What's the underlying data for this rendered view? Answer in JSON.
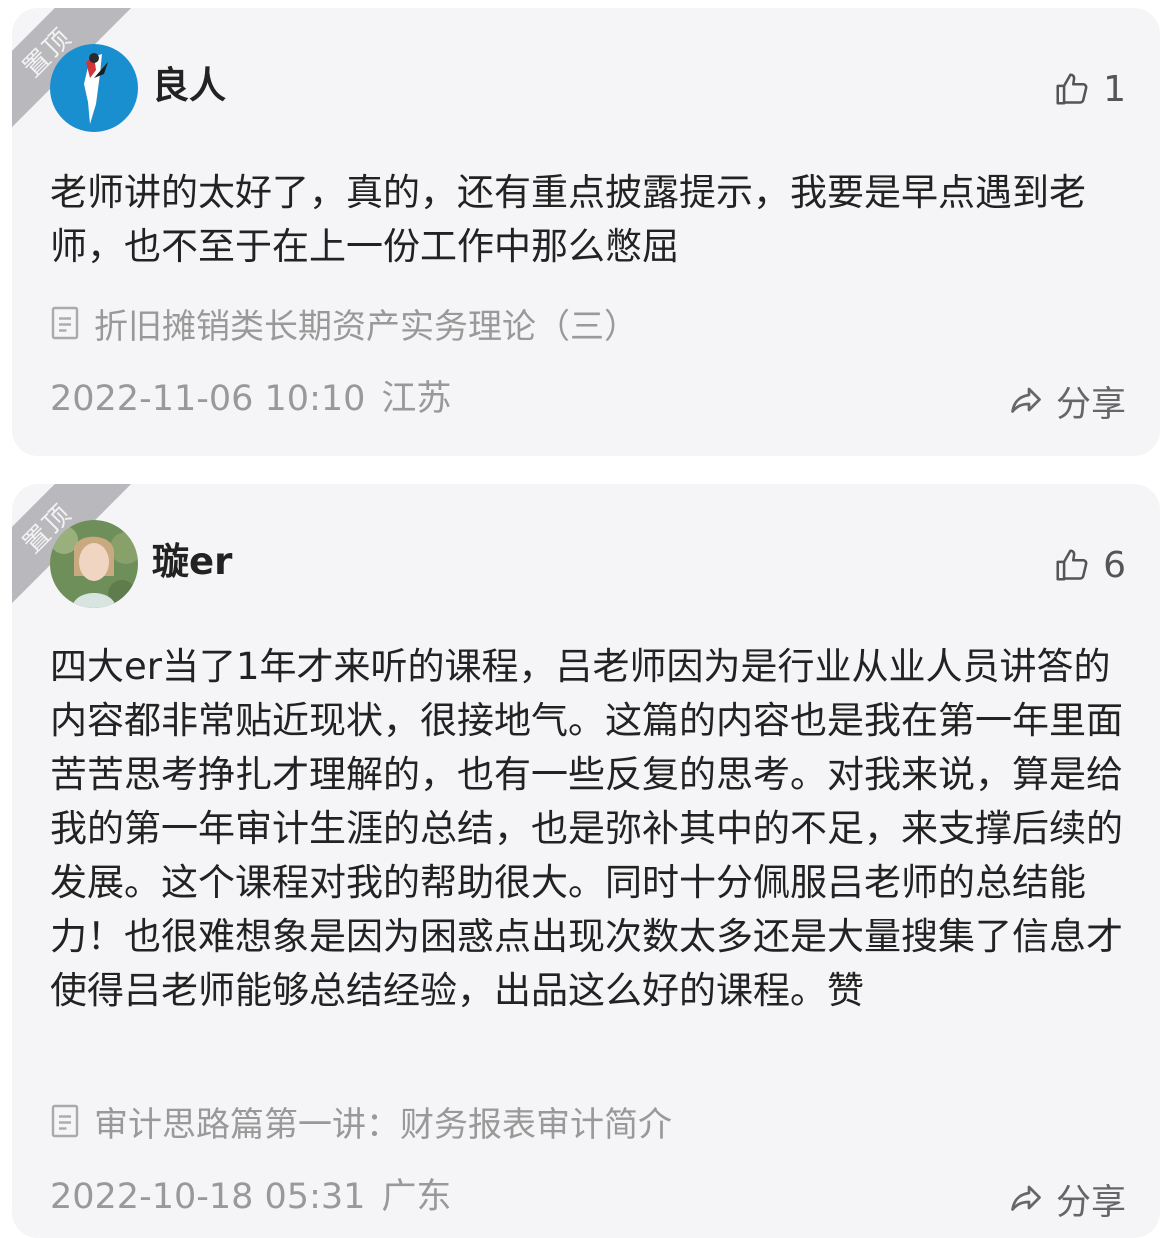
{
  "comments": [
    {
      "pin_label": "置顶",
      "author": "良人",
      "likes": "1",
      "text": "老师讲的太好了，真的，还有重点披露提示，我要是早点遇到老师，也不至于在上一份工作中那么憋屈",
      "article_title": "折旧摊销类长期资产实务理论（三）",
      "timestamp": "2022-11-06 10:10",
      "location": "江苏",
      "share_label": "分享"
    },
    {
      "pin_label": "置顶",
      "author": "璇er",
      "likes": "6",
      "text": "四大er当了1年才来听的课程，吕老师因为是行业从业人员讲答的内容都非常贴近现状，很接地气。这篇的内容也是我在第一年里面苦苦思考挣扎才理解的，也有一些反复的思考。对我来说，算是给我的第一年审计生涯的总结，也是弥补其中的不足，来支撑后续的发展。这个课程对我的帮助很大。同时十分佩服吕老师的总结能力！也很难想象是因为困惑点出现次数太多还是大量搜集了信息才使得吕老师能够总结经验，出品这么好的课程。赞",
      "article_title": "审计思路篇第一讲：财务报表审计简介",
      "timestamp": "2022-10-18 05:31",
      "location": "广东",
      "share_label": "分享"
    }
  ],
  "icons": {
    "like": "thumbs-up-icon",
    "article": "document-icon",
    "share": "share-arrow-icon"
  }
}
